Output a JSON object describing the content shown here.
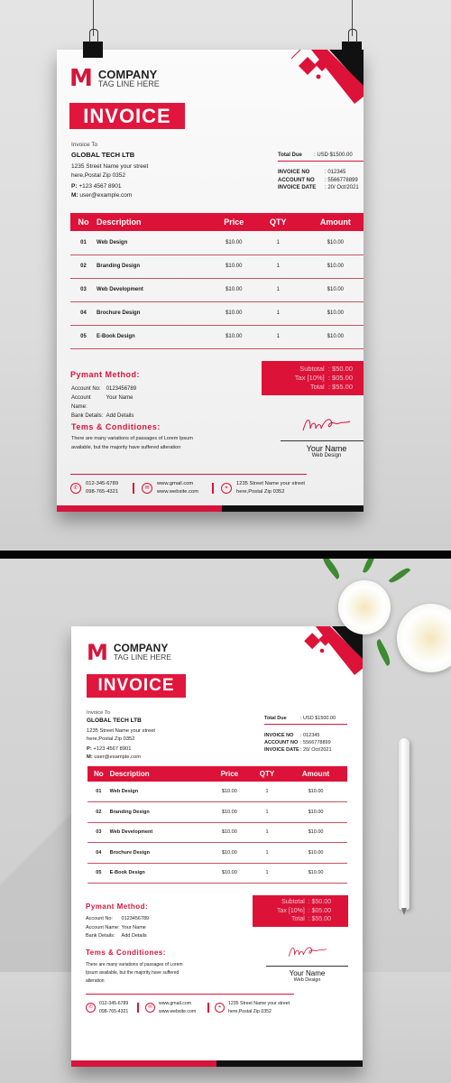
{
  "invoice": {
    "company": "COMPANY",
    "tagline": "TAG LINE HERE",
    "logo_letter": "M",
    "title": "INVOICE",
    "invoice_to_label": "Invoice To",
    "client_name": "GLOBAL TECH LTB",
    "client_address_1": "1235 Street Name your street",
    "client_address_2": "here,Postal Zip 0352",
    "phone_label": "P:",
    "phone": "+123 4567 8901",
    "mail_label": "M:",
    "email": "user@example.com",
    "total_due_label": "Total Due",
    "total_due_value": ": USD $1500.00",
    "meta": [
      {
        "label": "INVOICE NO",
        "value": ": 012345"
      },
      {
        "label": "ACCOUNT NO",
        "value": ": 5566778899"
      },
      {
        "label": "INVOICE DATE",
        "value": ": 20/ Oct/2021"
      }
    ],
    "table_headers": [
      "No",
      "Description",
      "Price",
      "QTY",
      "Amount"
    ],
    "rows": [
      {
        "no": "01",
        "desc": "Web Design",
        "price": "$10.00",
        "qty": "1",
        "amount": "$10.00"
      },
      {
        "no": "02",
        "desc": "Branding Design",
        "price": "$10.00",
        "qty": "1",
        "amount": "$10.00"
      },
      {
        "no": "03",
        "desc": "Web Development",
        "price": "$10.00",
        "qty": "1",
        "amount": "$10.00"
      },
      {
        "no": "04",
        "desc": "Brochure Design",
        "price": "$10.00",
        "qty": "1",
        "amount": "$10.00"
      },
      {
        "no": "05",
        "desc": "E-Book Design",
        "price": "$10.00",
        "qty": "1",
        "amount": "$10.00"
      }
    ],
    "totals": [
      {
        "label": "Subtotal",
        "value": ": $50.00"
      },
      {
        "label": "Tax [10%]",
        "value": ": $05.00"
      },
      {
        "label": "Total",
        "value": ": $55.00"
      }
    ],
    "payment_heading": "Pymant Method:",
    "payment": [
      {
        "label": "Account No:",
        "value": "0123456789"
      },
      {
        "label": "Account Name:",
        "value": "Your Name"
      },
      {
        "label": "Bank Details:",
        "value": "Add Details"
      }
    ],
    "terms_heading": "Tems & Conditiones:",
    "terms_text": "There are many variations of passages of Lorem Ipsum available, but the majority have suffered alteration",
    "signer_name": "Your Name",
    "signer_role": "Web Design",
    "footer": {
      "phone_1": "012-345-6789",
      "phone_2": "098-765-4321",
      "email": "www.gmail.com",
      "website": "www.website.com",
      "address_1": "1235 Street Name your street",
      "address_2": "here,Postal Zip 0352"
    }
  },
  "icons": {
    "phone": "✆",
    "mail": "✉",
    "location": "⌖"
  },
  "colors": {
    "brand_red": "#dc1238",
    "dark": "#111111"
  }
}
